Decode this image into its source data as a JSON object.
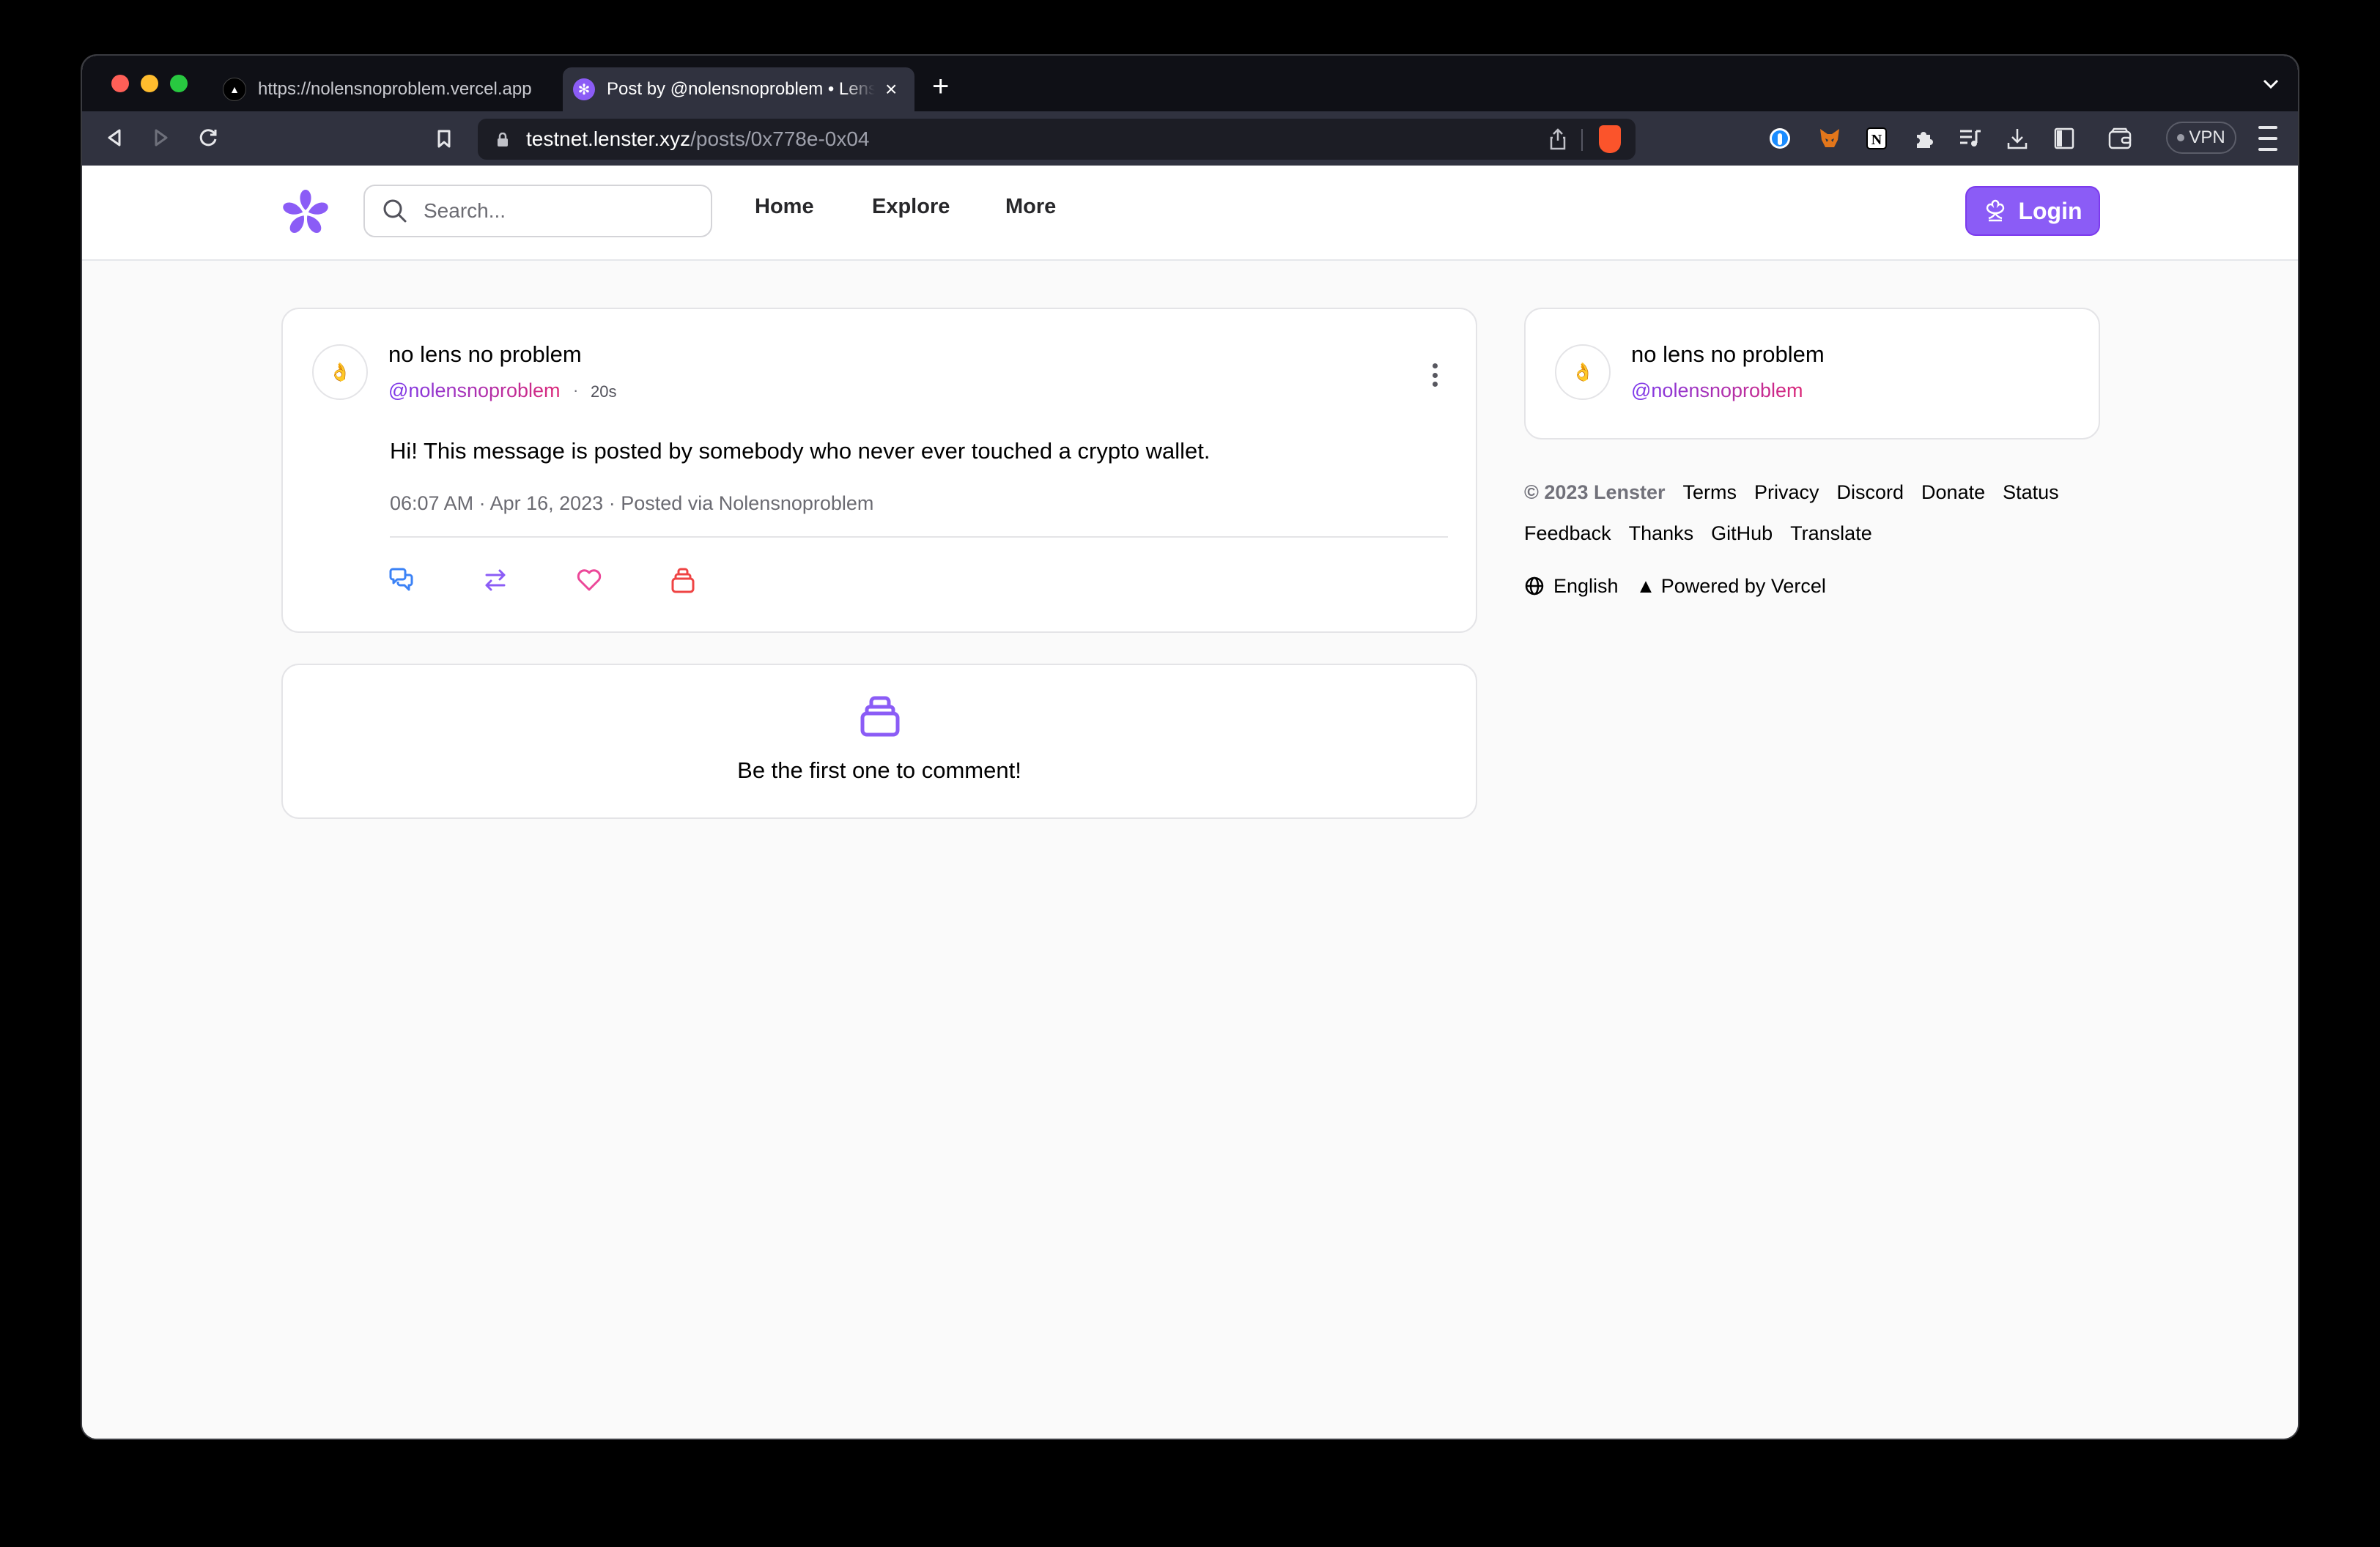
{
  "browser": {
    "tabs": [
      {
        "title": "https://nolensnoproblem.vercel.app",
        "favicon": "vercel-triangle-icon",
        "active": false
      },
      {
        "title": "Post by @nolensnoproblem • Lenster",
        "favicon": "lenster-flower-icon",
        "active": true
      }
    ],
    "new_tab_label": "+",
    "address": {
      "host": "testnet.lenster.xyz",
      "path": "/posts/0x778e-0x04"
    },
    "vpn_label": "VPN",
    "extensions": [
      "one-password-icon",
      "metamask-fox-icon",
      "notion-icon",
      "puzzle-extensions-icon",
      "playlist-icon",
      "download-icon",
      "sidebar-icon",
      "wallet-icon"
    ]
  },
  "header": {
    "search_placeholder": "Search...",
    "nav": [
      {
        "label": "Home"
      },
      {
        "label": "Explore"
      },
      {
        "label": "More"
      }
    ],
    "login_label": "Login"
  },
  "post": {
    "author_name": "no lens no problem",
    "author_handle": "@nolensnoproblem",
    "avatar_emoji": "👌",
    "relative_time": "20s",
    "separator": "·",
    "body": "Hi! This message is posted by somebody who never ever touched a crypto wallet.",
    "meta": "06:07 AM · Apr 16, 2023 · Posted via Nolensnoproblem",
    "actions": [
      {
        "name": "comment",
        "color": "#3b82f6"
      },
      {
        "name": "mirror",
        "color": "#8b5cf6"
      },
      {
        "name": "like",
        "color": "#ec4899"
      },
      {
        "name": "collect",
        "color": "#ef4444"
      }
    ]
  },
  "comments": {
    "empty_message": "Be the first one to comment!"
  },
  "sidebar_profile": {
    "name": "no lens no problem",
    "handle": "@nolensnoproblem",
    "avatar_emoji": "👌"
  },
  "footer": {
    "copyright": "© 2023 Lenster",
    "links_row1": [
      "Terms",
      "Privacy",
      "Discord",
      "Donate",
      "Status"
    ],
    "links_row2": [
      "Feedback",
      "Thanks",
      "GitHub",
      "Translate"
    ],
    "language": "English",
    "powered_by": "▲ Powered by Vercel"
  },
  "colors": {
    "brand": "#8b5cf6",
    "handle_gradient_start": "#7c3aed",
    "handle_gradient_end": "#db2777"
  }
}
